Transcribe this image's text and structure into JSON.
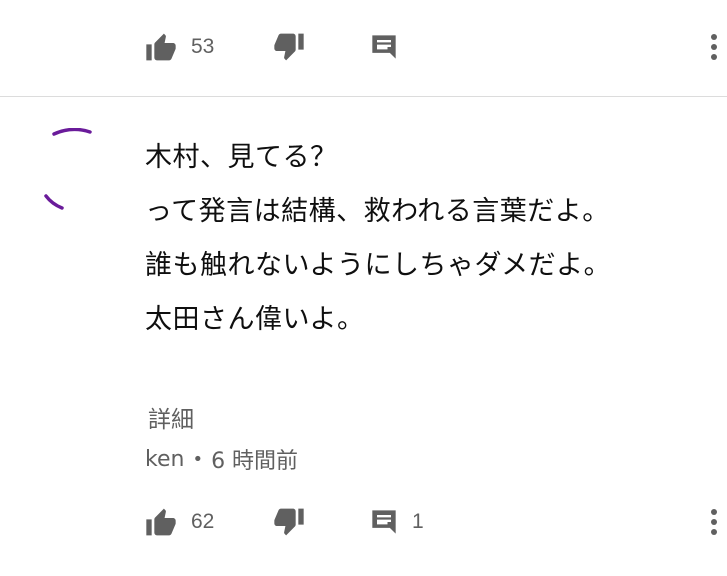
{
  "previous_comment": {
    "like_count": "53",
    "icons": {
      "like": "thumbs-up-icon",
      "dislike": "thumbs-down-icon",
      "reply": "comment-icon",
      "more": "more-vert-icon"
    }
  },
  "comment": {
    "lines": [
      "木村、見てる？",
      "って発言は結構、救われる言葉だよ。",
      "誰も触れないようにしちゃダメだよ。",
      "太田さん偉いよ。"
    ],
    "details_label": "詳細",
    "author": "ken",
    "separator": "•",
    "time": "6 時間前",
    "like_count": "62",
    "reply_count": "1",
    "avatar_color": "#6a1b9a"
  },
  "colors": {
    "icon": "#606060",
    "text": "#0f0f0f",
    "secondary_text": "#606060",
    "divider": "#dcdcdc"
  }
}
